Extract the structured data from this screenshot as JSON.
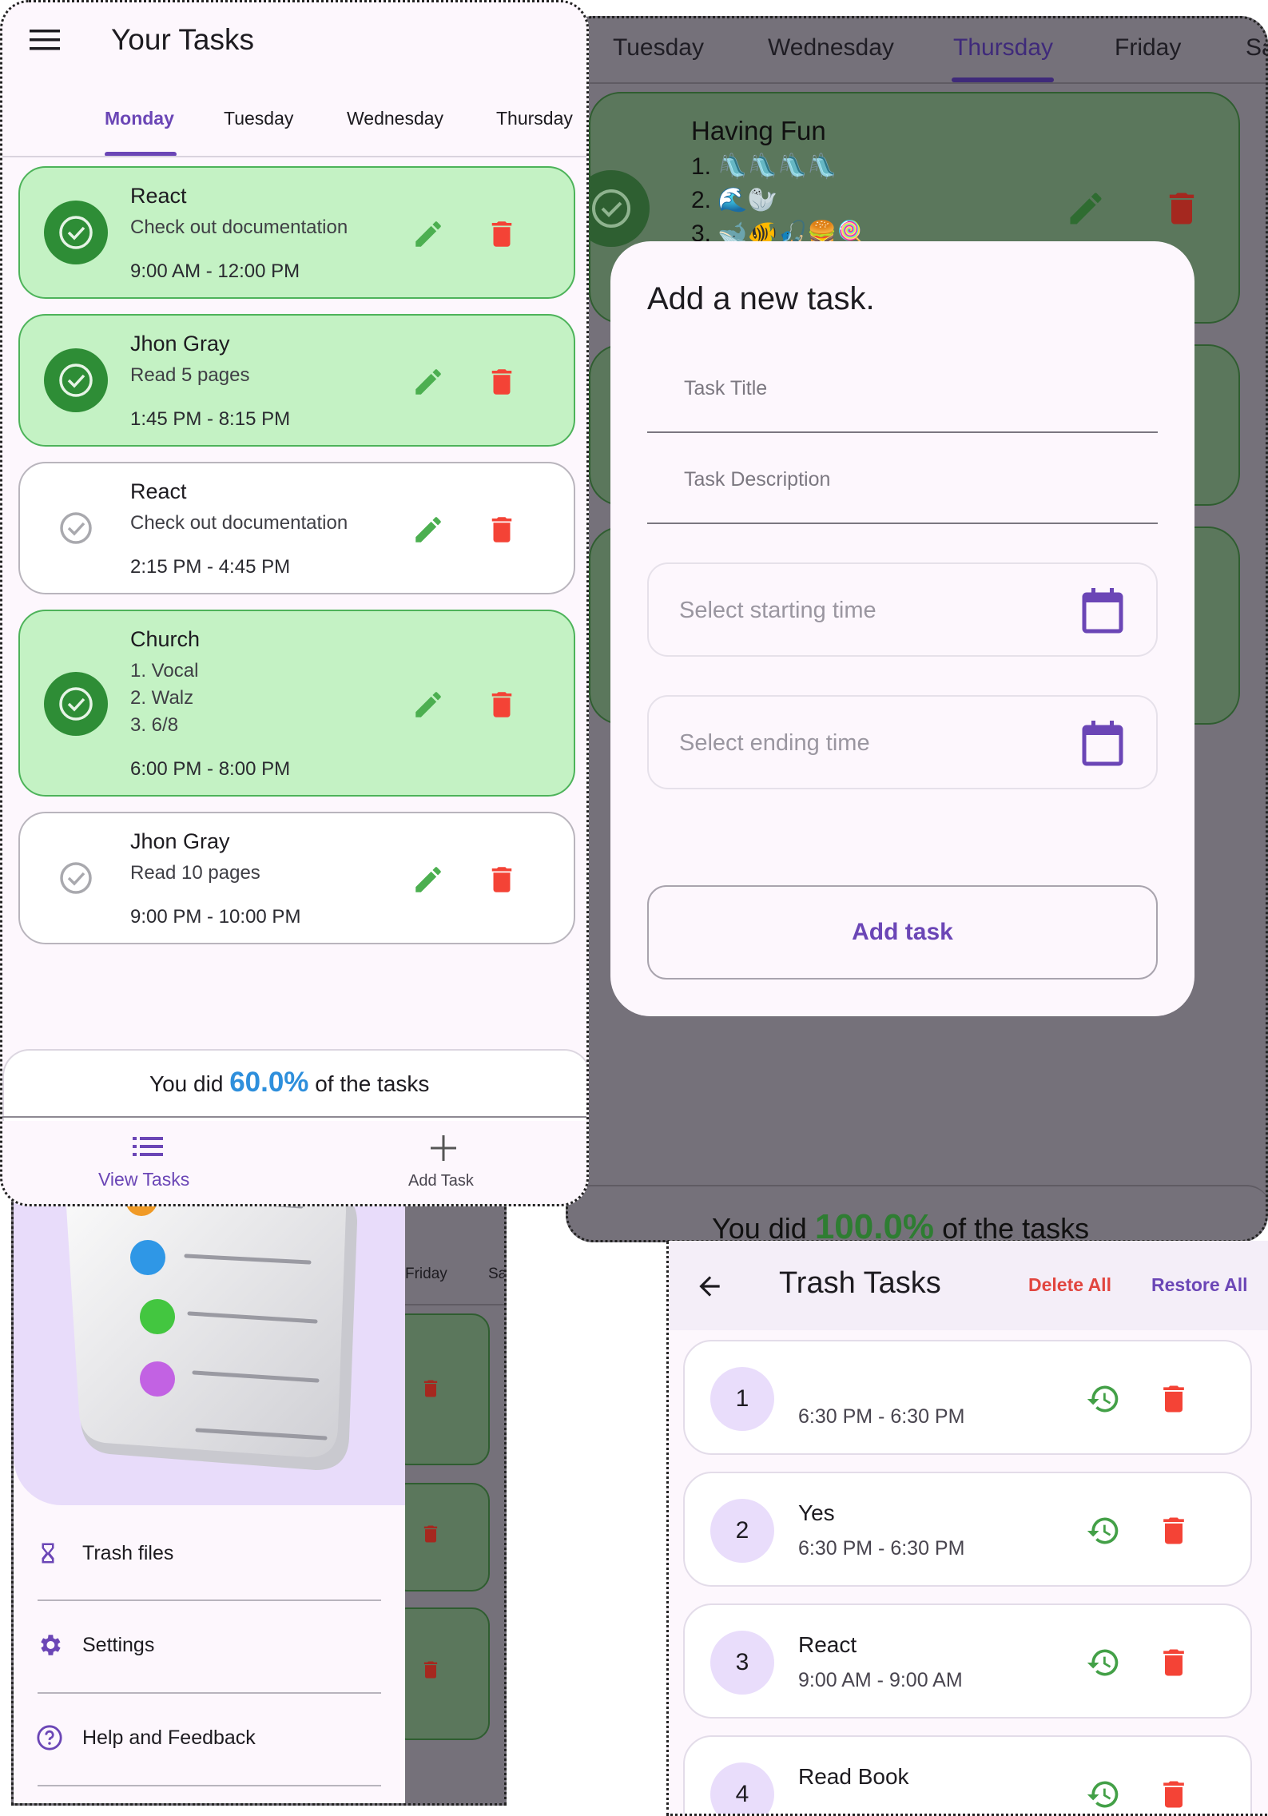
{
  "main": {
    "app_title": "Your Tasks",
    "tabs": [
      "Monday",
      "Tuesday",
      "Wednesday",
      "Thursday"
    ],
    "active_tab": "Monday",
    "tasks": [
      {
        "title": "React",
        "desc": "Check out documentation",
        "time": "9:00 AM - 12:00 PM",
        "done": true
      },
      {
        "title": "Jhon Gray",
        "desc": "Read 5 pages",
        "time": "1:45 PM - 8:15 PM",
        "done": true
      },
      {
        "title": "React",
        "desc": "Check out documentation",
        "time": "2:15 PM - 4:45 PM",
        "done": false
      },
      {
        "title": "Church",
        "desc": "1. Vocal\n2. Walz\n3. 6/8",
        "time": "6:00 PM - 8:00 PM",
        "done": true
      },
      {
        "title": "Jhon Gray",
        "desc": "Read 10 pages",
        "time": "9:00 PM - 10:00 PM",
        "done": false
      }
    ],
    "progress": {
      "prefix": "You did",
      "value": "60.0%",
      "suffix": "of the tasks",
      "value_color": "#2e8fdc"
    },
    "bottom_nav": {
      "view_label": "View Tasks",
      "add_label": "Add Task"
    }
  },
  "thursday_screen": {
    "tabs": [
      "Tuesday",
      "Wednesday",
      "Thursday",
      "Friday",
      "Sa"
    ],
    "active_tab": "Thursday",
    "task_title": "Having Fun",
    "task_lines": [
      "1. 🛝🛝🛝🛝",
      "2. 🌊🦭",
      "3. 🐋🐠🎣🍔🍭"
    ],
    "progress": {
      "prefix": "You did",
      "value": "100.0%",
      "suffix": "of the tasks",
      "value_color": "#2e7d32"
    }
  },
  "dialog": {
    "title": "Add a new task.",
    "title_placeholder": "Task Title",
    "desc_placeholder": "Task Description",
    "start_placeholder": "Select starting time",
    "end_placeholder": "Select ending time",
    "submit_label": "Add task"
  },
  "drawer": {
    "background_tabs": [
      "Friday",
      "Sa"
    ],
    "items": [
      {
        "label": "Trash files",
        "icon": "hourglass-icon"
      },
      {
        "label": "Settings",
        "icon": "gear-icon"
      },
      {
        "label": "Help and Feedback",
        "icon": "help-icon"
      }
    ]
  },
  "trash": {
    "title": "Trash Tasks",
    "delete_all": "Delete All",
    "restore_all": "Restore All",
    "items": [
      {
        "num": "1",
        "title": "",
        "time": "6:30 PM - 6:30 PM"
      },
      {
        "num": "2",
        "title": "Yes",
        "time": "6:30 PM - 6:30 PM"
      },
      {
        "num": "3",
        "title": "React",
        "time": "9:00 AM - 9:00 AM"
      },
      {
        "num": "4",
        "title": "Read Book",
        "time": ""
      }
    ]
  },
  "colors": {
    "accent": "#6b46b6",
    "done_bg": "#c4f2c4",
    "edit": "#4caf50",
    "delete": "#f44336"
  }
}
